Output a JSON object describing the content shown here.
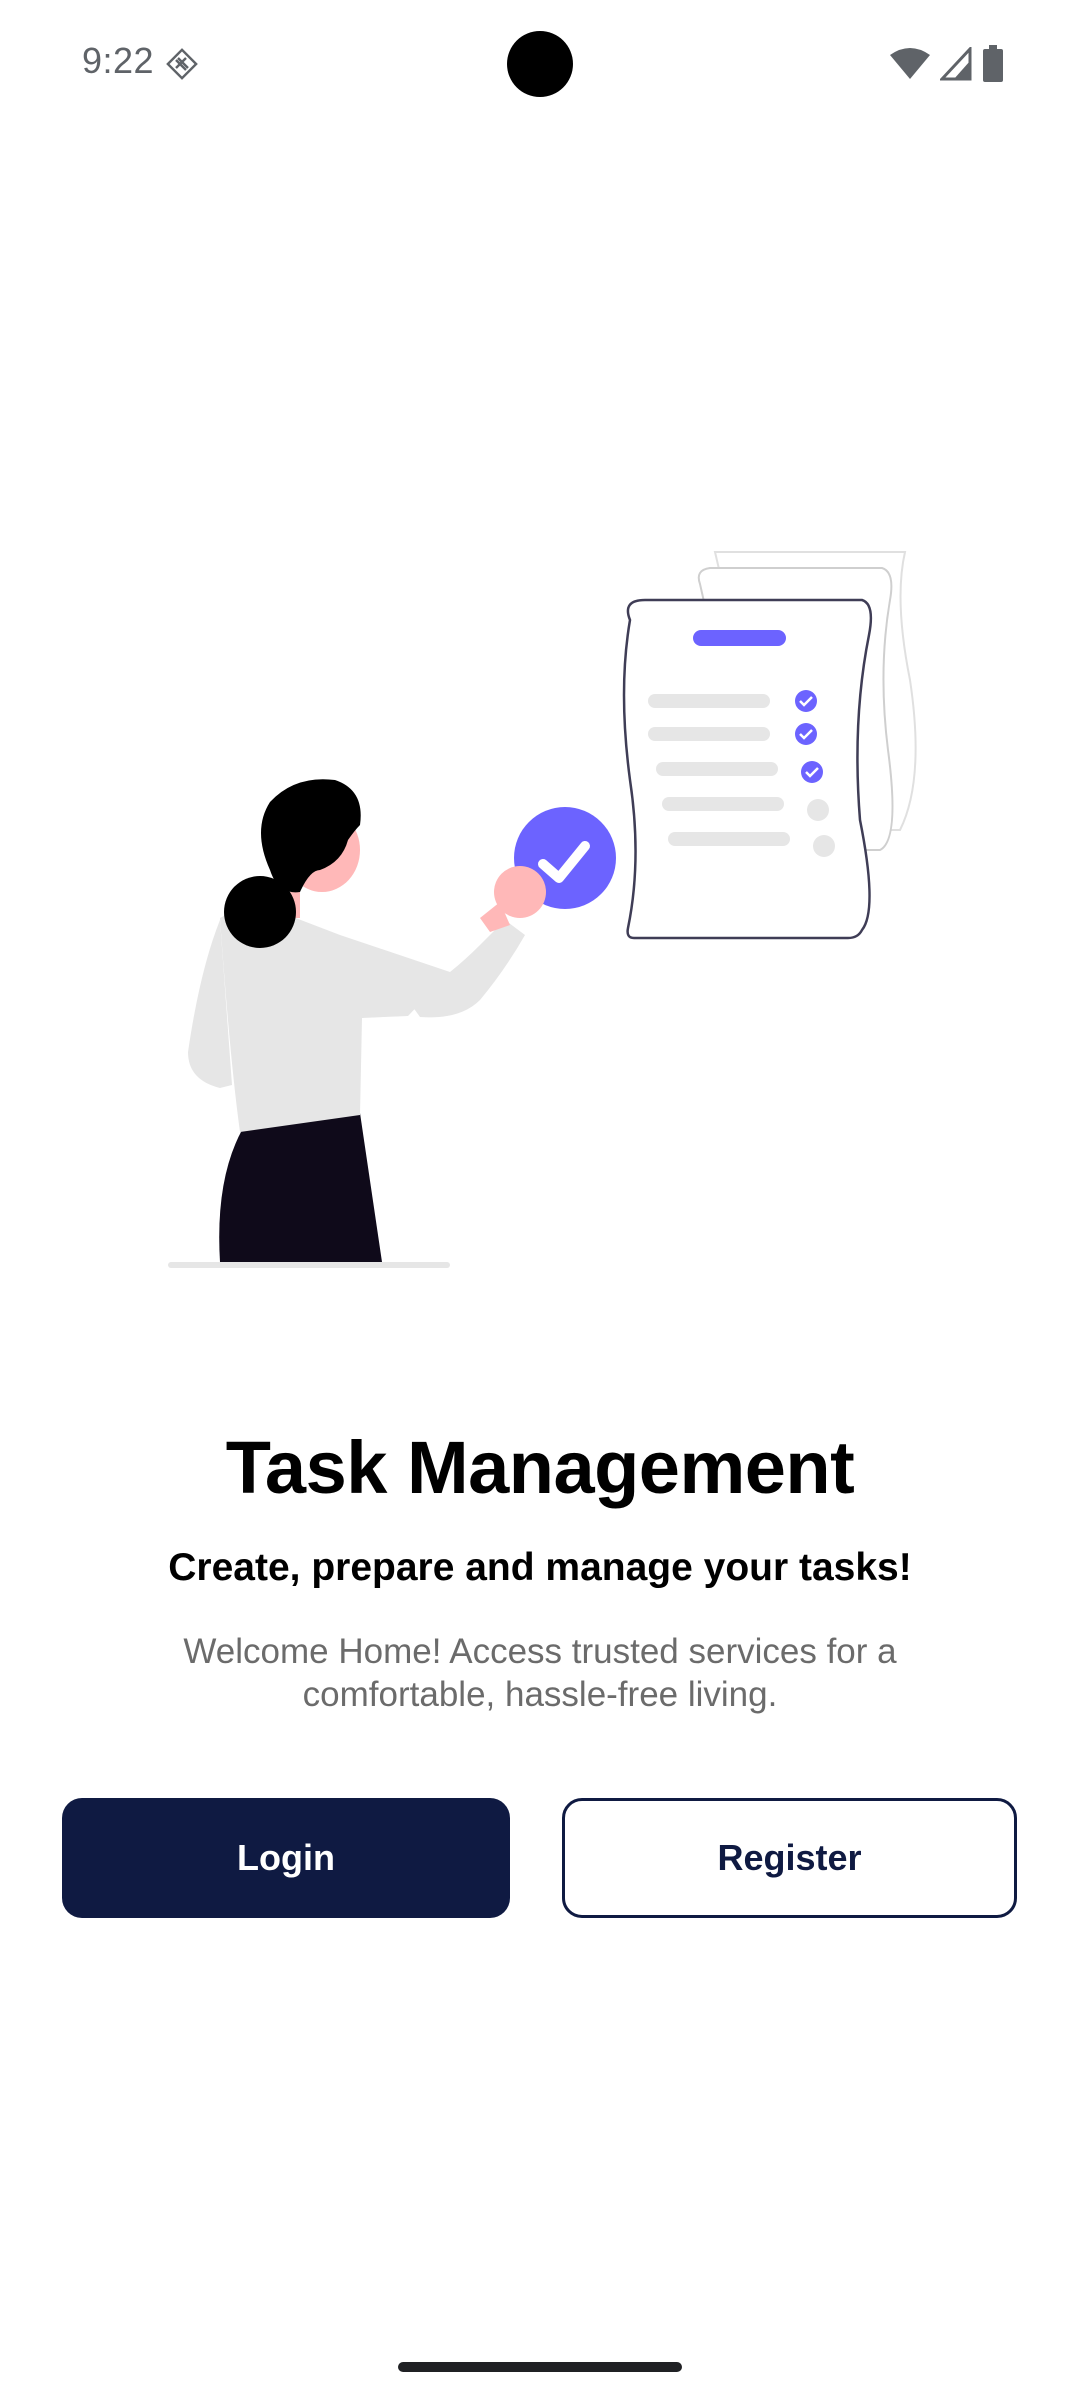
{
  "status_bar": {
    "time": "9:22",
    "icons": [
      "notification-icon",
      "wifi-icon",
      "cellular-signal-icon",
      "battery-icon"
    ]
  },
  "illustration": {
    "name": "person-checking-task-list",
    "colors": {
      "accent": "#6c63ff",
      "hair": "#000000",
      "skin": "#ffb8b8",
      "shirt": "#e6e6e6",
      "skirt": "#0f0a1a",
      "outline": "#3f3d56"
    }
  },
  "main": {
    "title": "Task Management",
    "subtitle": "Create, prepare and manage your tasks!",
    "description": "Welcome Home! Access trusted services for a comfortable, hassle-free living."
  },
  "actions": {
    "login_label": "Login",
    "register_label": "Register"
  },
  "colors": {
    "primary": "#0f1a42",
    "accent": "#6c63ff",
    "text_secondary": "#6b6b6b"
  }
}
